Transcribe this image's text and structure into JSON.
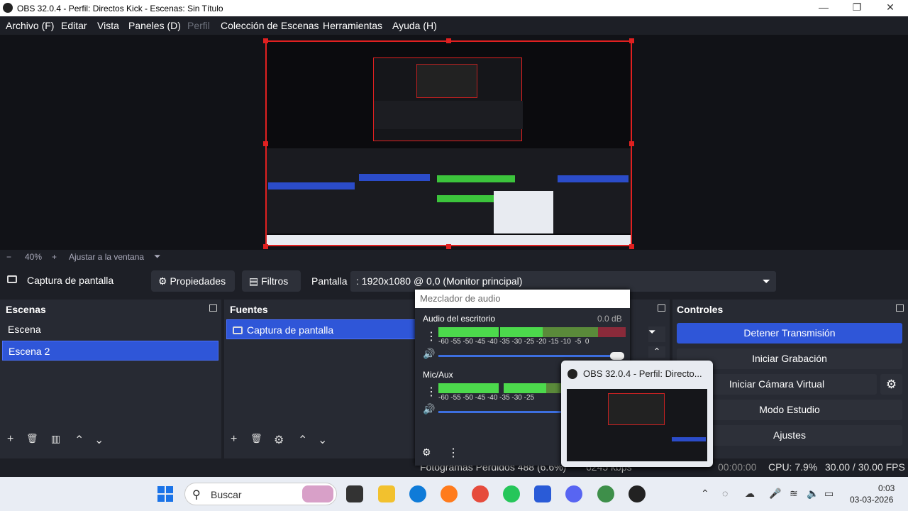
{
  "window": {
    "title": "OBS 32.0.4 - Perfil: Directos Kick - Escenas: Sin Título",
    "minimize": "—",
    "maximize": "❐",
    "close": "✕"
  },
  "menu": {
    "archivo": "Archivo (F)",
    "editar": "Editar",
    "vista": "Vista",
    "paneles": "Paneles (D)",
    "perfil": "Perfil",
    "coleccion": "Colección de Escenas",
    "herramientas": "Herramientas",
    "ayuda": "Ayuda (H)"
  },
  "zoom": {
    "minus": "−",
    "level": "40%",
    "plus": "+",
    "fit": "Ajustar a la ventana",
    "arrow": "⏷"
  },
  "source_toolbar": {
    "source_name": "Captura de pantalla",
    "properties": "Propiedades",
    "filters": "Filtros",
    "display_label": "Pantalla",
    "display_value": ": 1920x1080 @ 0,0 (Monitor principal)"
  },
  "scenes": {
    "title": "Escenas",
    "items": [
      "Escena",
      "Escena 2"
    ]
  },
  "sources": {
    "title": "Fuentes",
    "items": [
      "Captura de pantalla"
    ]
  },
  "mixer": {
    "title": "Mezclador de audio",
    "channels": [
      {
        "name": "Audio del escritorio",
        "db": "0.0 dB"
      },
      {
        "name": "Mic/Aux",
        "db": ""
      }
    ],
    "ticks": [
      "-60",
      "-55",
      "-50",
      "-45",
      "-40",
      "-35",
      "-30",
      "-25",
      "-20",
      "-15",
      "-10",
      "-5",
      "0"
    ]
  },
  "controls": {
    "title": "Controles",
    "stop_stream": "Detener Transmisión",
    "start_record": "Iniciar Grabación",
    "virtual_cam": "Iniciar Cámara Virtual",
    "studio_mode": "Modo Estudio",
    "settings": "Ajustes"
  },
  "status": {
    "dropped": "Fotogramas Perdidos 488 (6.6%)",
    "bitrate": "6245 kbps",
    "time": "00:00:00",
    "cpu": "CPU: 7.9%",
    "fps": "30.00 / 30.00 FPS"
  },
  "thumbnail": {
    "title": "OBS 32.0.4 - Perfil: Directo..."
  },
  "taskbar": {
    "search": "Buscar",
    "time": "0:03",
    "date": "03-03-2026"
  },
  "icons": {
    "settings": "⚙",
    "menu": "⋮",
    "volume": "🔊",
    "add": "+",
    "remove": "🗑",
    "up": "⌃",
    "down": "⌄"
  }
}
